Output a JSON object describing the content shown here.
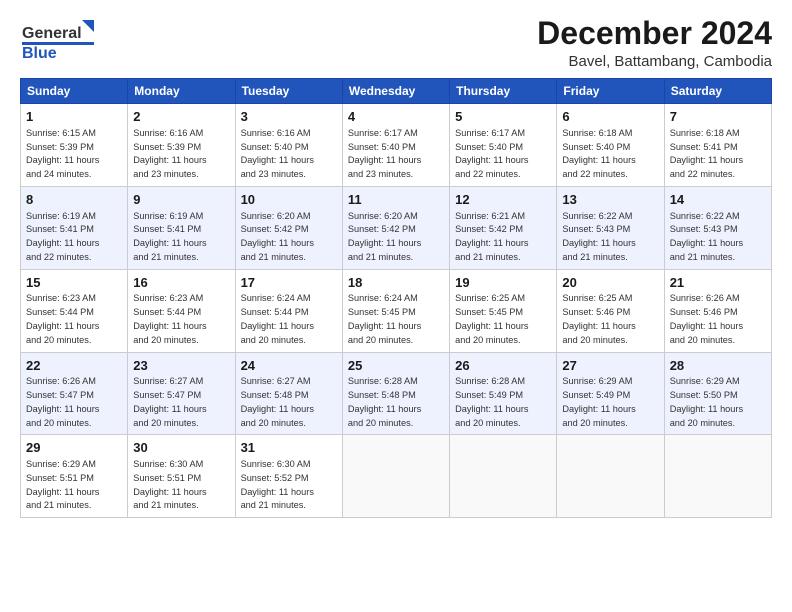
{
  "header": {
    "logo_line1": "General",
    "logo_line2": "Blue",
    "main_title": "December 2024",
    "subtitle": "Bavel, Battambang, Cambodia"
  },
  "calendar": {
    "weekdays": [
      "Sunday",
      "Monday",
      "Tuesday",
      "Wednesday",
      "Thursday",
      "Friday",
      "Saturday"
    ],
    "weeks": [
      [
        {
          "day": "1",
          "sunrise": "6:15 AM",
          "sunset": "5:39 PM",
          "daylight": "11 hours and 24 minutes."
        },
        {
          "day": "2",
          "sunrise": "6:16 AM",
          "sunset": "5:39 PM",
          "daylight": "11 hours and 23 minutes."
        },
        {
          "day": "3",
          "sunrise": "6:16 AM",
          "sunset": "5:40 PM",
          "daylight": "11 hours and 23 minutes."
        },
        {
          "day": "4",
          "sunrise": "6:17 AM",
          "sunset": "5:40 PM",
          "daylight": "11 hours and 23 minutes."
        },
        {
          "day": "5",
          "sunrise": "6:17 AM",
          "sunset": "5:40 PM",
          "daylight": "11 hours and 22 minutes."
        },
        {
          "day": "6",
          "sunrise": "6:18 AM",
          "sunset": "5:40 PM",
          "daylight": "11 hours and 22 minutes."
        },
        {
          "day": "7",
          "sunrise": "6:18 AM",
          "sunset": "5:41 PM",
          "daylight": "11 hours and 22 minutes."
        }
      ],
      [
        {
          "day": "8",
          "sunrise": "6:19 AM",
          "sunset": "5:41 PM",
          "daylight": "11 hours and 22 minutes."
        },
        {
          "day": "9",
          "sunrise": "6:19 AM",
          "sunset": "5:41 PM",
          "daylight": "11 hours and 21 minutes."
        },
        {
          "day": "10",
          "sunrise": "6:20 AM",
          "sunset": "5:42 PM",
          "daylight": "11 hours and 21 minutes."
        },
        {
          "day": "11",
          "sunrise": "6:20 AM",
          "sunset": "5:42 PM",
          "daylight": "11 hours and 21 minutes."
        },
        {
          "day": "12",
          "sunrise": "6:21 AM",
          "sunset": "5:42 PM",
          "daylight": "11 hours and 21 minutes."
        },
        {
          "day": "13",
          "sunrise": "6:22 AM",
          "sunset": "5:43 PM",
          "daylight": "11 hours and 21 minutes."
        },
        {
          "day": "14",
          "sunrise": "6:22 AM",
          "sunset": "5:43 PM",
          "daylight": "11 hours and 21 minutes."
        }
      ],
      [
        {
          "day": "15",
          "sunrise": "6:23 AM",
          "sunset": "5:44 PM",
          "daylight": "11 hours and 20 minutes."
        },
        {
          "day": "16",
          "sunrise": "6:23 AM",
          "sunset": "5:44 PM",
          "daylight": "11 hours and 20 minutes."
        },
        {
          "day": "17",
          "sunrise": "6:24 AM",
          "sunset": "5:44 PM",
          "daylight": "11 hours and 20 minutes."
        },
        {
          "day": "18",
          "sunrise": "6:24 AM",
          "sunset": "5:45 PM",
          "daylight": "11 hours and 20 minutes."
        },
        {
          "day": "19",
          "sunrise": "6:25 AM",
          "sunset": "5:45 PM",
          "daylight": "11 hours and 20 minutes."
        },
        {
          "day": "20",
          "sunrise": "6:25 AM",
          "sunset": "5:46 PM",
          "daylight": "11 hours and 20 minutes."
        },
        {
          "day": "21",
          "sunrise": "6:26 AM",
          "sunset": "5:46 PM",
          "daylight": "11 hours and 20 minutes."
        }
      ],
      [
        {
          "day": "22",
          "sunrise": "6:26 AM",
          "sunset": "5:47 PM",
          "daylight": "11 hours and 20 minutes."
        },
        {
          "day": "23",
          "sunrise": "6:27 AM",
          "sunset": "5:47 PM",
          "daylight": "11 hours and 20 minutes."
        },
        {
          "day": "24",
          "sunrise": "6:27 AM",
          "sunset": "5:48 PM",
          "daylight": "11 hours and 20 minutes."
        },
        {
          "day": "25",
          "sunrise": "6:28 AM",
          "sunset": "5:48 PM",
          "daylight": "11 hours and 20 minutes."
        },
        {
          "day": "26",
          "sunrise": "6:28 AM",
          "sunset": "5:49 PM",
          "daylight": "11 hours and 20 minutes."
        },
        {
          "day": "27",
          "sunrise": "6:29 AM",
          "sunset": "5:49 PM",
          "daylight": "11 hours and 20 minutes."
        },
        {
          "day": "28",
          "sunrise": "6:29 AM",
          "sunset": "5:50 PM",
          "daylight": "11 hours and 20 minutes."
        }
      ],
      [
        {
          "day": "29",
          "sunrise": "6:29 AM",
          "sunset": "5:51 PM",
          "daylight": "11 hours and 21 minutes."
        },
        {
          "day": "30",
          "sunrise": "6:30 AM",
          "sunset": "5:51 PM",
          "daylight": "11 hours and 21 minutes."
        },
        {
          "day": "31",
          "sunrise": "6:30 AM",
          "sunset": "5:52 PM",
          "daylight": "11 hours and 21 minutes."
        },
        null,
        null,
        null,
        null
      ]
    ]
  },
  "labels": {
    "sunrise": "Sunrise:",
    "sunset": "Sunset:",
    "daylight": "Daylight:"
  }
}
